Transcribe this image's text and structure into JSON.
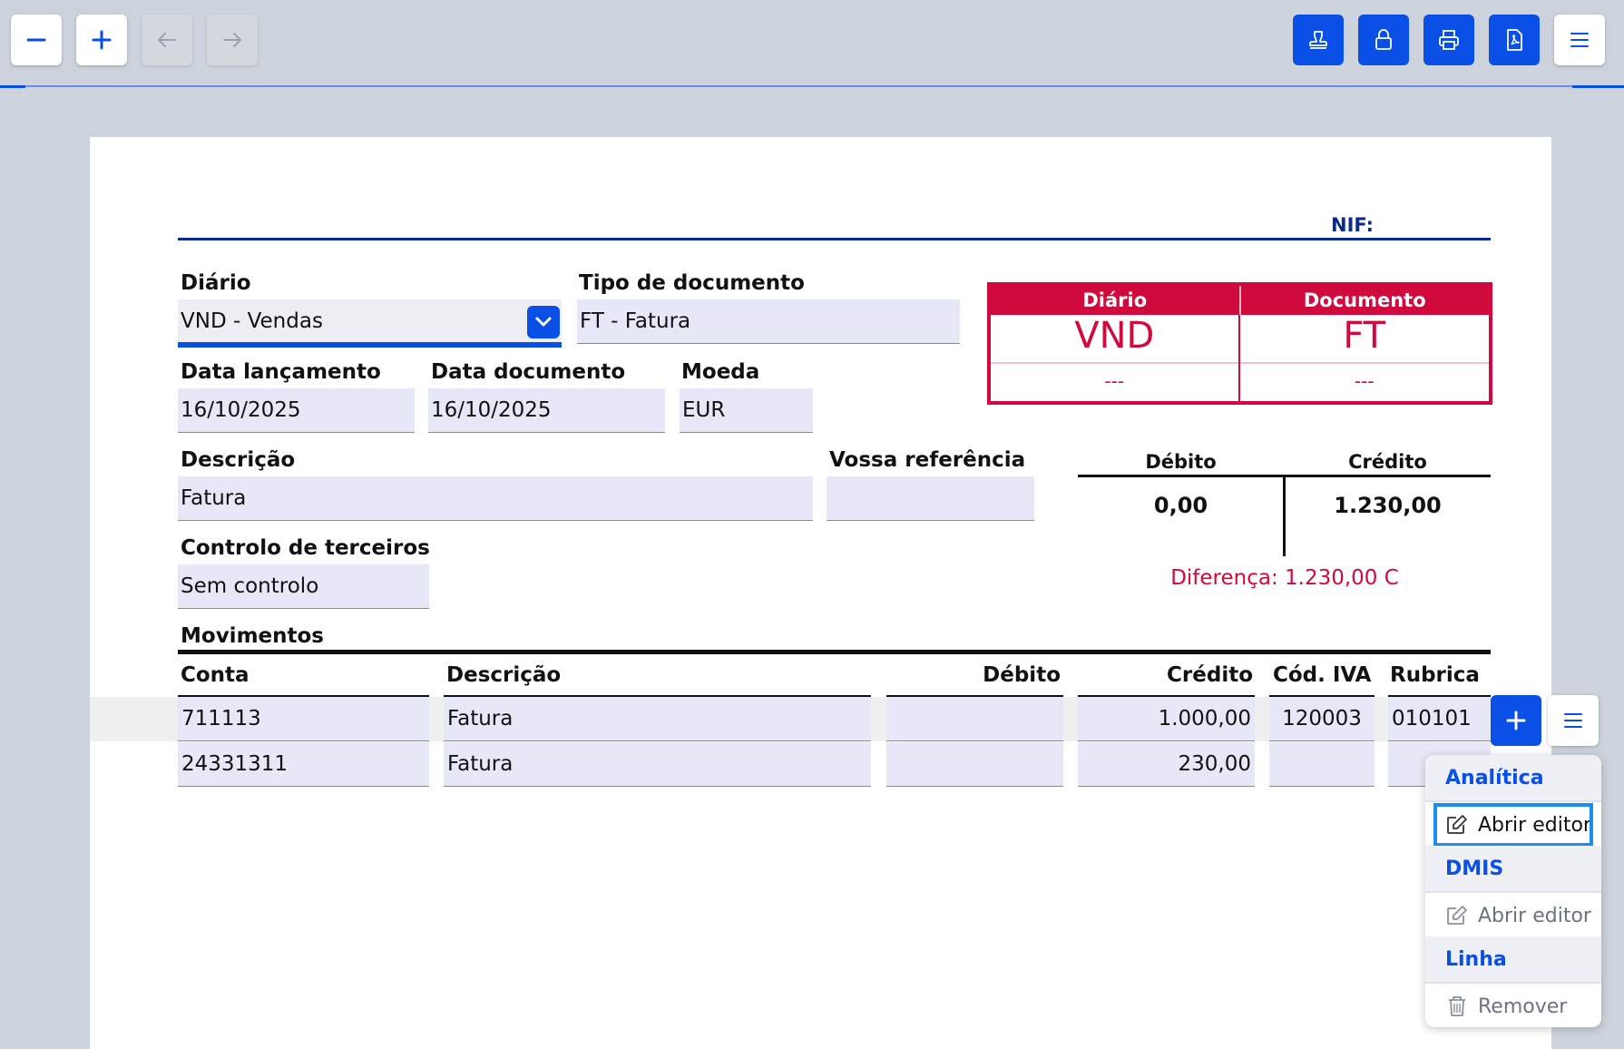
{
  "toolbar": {
    "left_buttons": [
      "zoom-out",
      "zoom-in",
      "back",
      "forward"
    ],
    "right_buttons": [
      "stamp",
      "lock",
      "print",
      "pdf",
      "menu"
    ],
    "accent": "#0a4fe6"
  },
  "header": {
    "nif_label": "NIF: "
  },
  "form": {
    "diario": {
      "label": "Diário",
      "value": "VND - Vendas"
    },
    "tipo_documento": {
      "label": "Tipo de documento",
      "value": "FT - Fatura"
    },
    "data_lancamento": {
      "label": "Data lançamento",
      "value": "16/10/2025"
    },
    "data_documento": {
      "label": "Data documento",
      "value": "16/10/2025"
    },
    "moeda": {
      "label": "Moeda",
      "value": "EUR"
    },
    "descricao": {
      "label": "Descrição",
      "value": "Fatura"
    },
    "vossa_referencia": {
      "label": "Vossa referência",
      "value": ""
    },
    "controlo_terceiros": {
      "label": "Controlo de terceiros",
      "value": "Sem controlo"
    }
  },
  "summary_box": {
    "col1_title": "Diário",
    "col1_code": "VND",
    "col1_number": "---",
    "col2_title": "Documento",
    "col2_code": "FT",
    "col2_number": "---",
    "color": "#d00a3c"
  },
  "totals": {
    "debit_label": "Débito",
    "credit_label": "Crédito",
    "debit_value": "0,00",
    "credit_value": "1.230,00",
    "difference": "Diferença: 1.230,00 C"
  },
  "movimentos": {
    "title": "Movimentos",
    "columns": [
      "Conta",
      "Descrição",
      "Débito",
      "Crédito",
      "Cód. IVA",
      "Rubrica"
    ],
    "rows": [
      {
        "conta": "711113",
        "descricao": "Fatura",
        "debito": "",
        "credito": "1.000,00",
        "cod_iva": "120003",
        "rubrica": "010101"
      },
      {
        "conta": "24331311",
        "descricao": "Fatura",
        "debito": "",
        "credito": "230,00",
        "cod_iva": "",
        "rubrica": ""
      }
    ]
  },
  "row_menu": {
    "section_analitica": "Analítica",
    "analitica_open": "Abrir editor",
    "section_dmis": "DMIS",
    "dmis_open": "Abrir editor",
    "section_linha": "Linha",
    "linha_remove": "Remover"
  }
}
